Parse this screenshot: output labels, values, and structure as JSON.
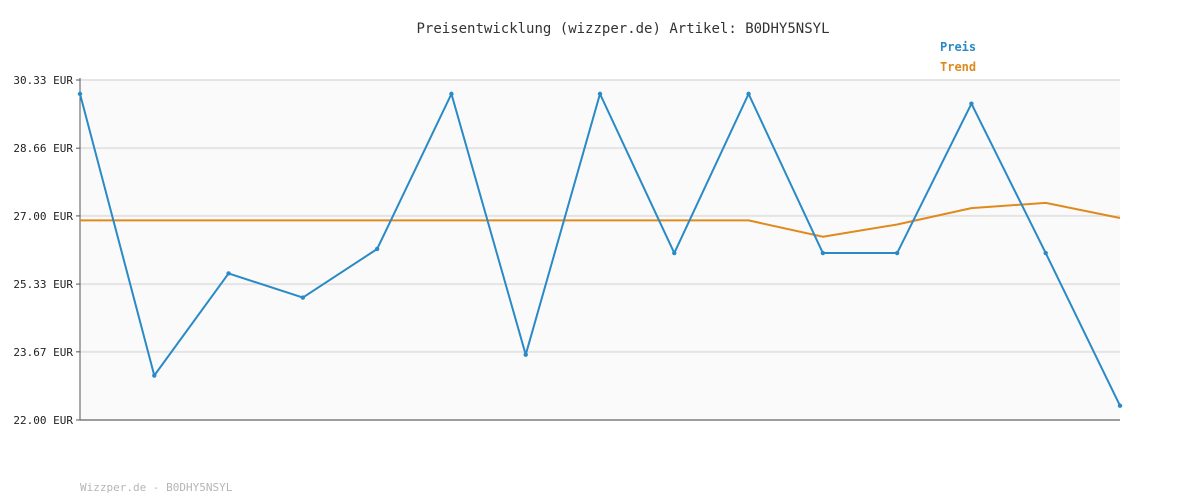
{
  "chart_data": {
    "type": "line",
    "title": "Preisentwicklung (wizzper.de) Artikel: B0DHY5NSYL",
    "xlabel": "",
    "ylabel": "",
    "ylim": [
      22.0,
      30.33
    ],
    "yticks": [
      "30.33 EUR",
      "28.66 EUR",
      "27.00 EUR",
      "25.33 EUR",
      "23.67 EUR",
      "22.00 EUR"
    ],
    "ytick_values": [
      30.33,
      28.66,
      27.0,
      25.33,
      23.67,
      22.0
    ],
    "grid": true,
    "legend": "top-right",
    "series": [
      {
        "name": "Preis",
        "color": "#2a8ac6",
        "values": [
          29.99,
          23.09,
          25.59,
          25.0,
          26.19,
          29.99,
          23.6,
          29.99,
          26.09,
          29.99,
          26.09,
          26.09,
          29.75,
          26.09,
          22.35
        ]
      },
      {
        "name": "Trend",
        "color": "#e08a1e",
        "values": [
          26.89,
          26.89,
          26.89,
          26.89,
          26.89,
          26.89,
          26.89,
          26.89,
          26.89,
          26.89,
          26.49,
          26.79,
          27.19,
          27.32,
          26.95
        ]
      }
    ]
  },
  "footer": "Wizzper.de - B0DHY5NSYL",
  "colors": {
    "plot_bg": "#fafafa",
    "grid": "#e4e4e4",
    "axis": "#555555"
  }
}
